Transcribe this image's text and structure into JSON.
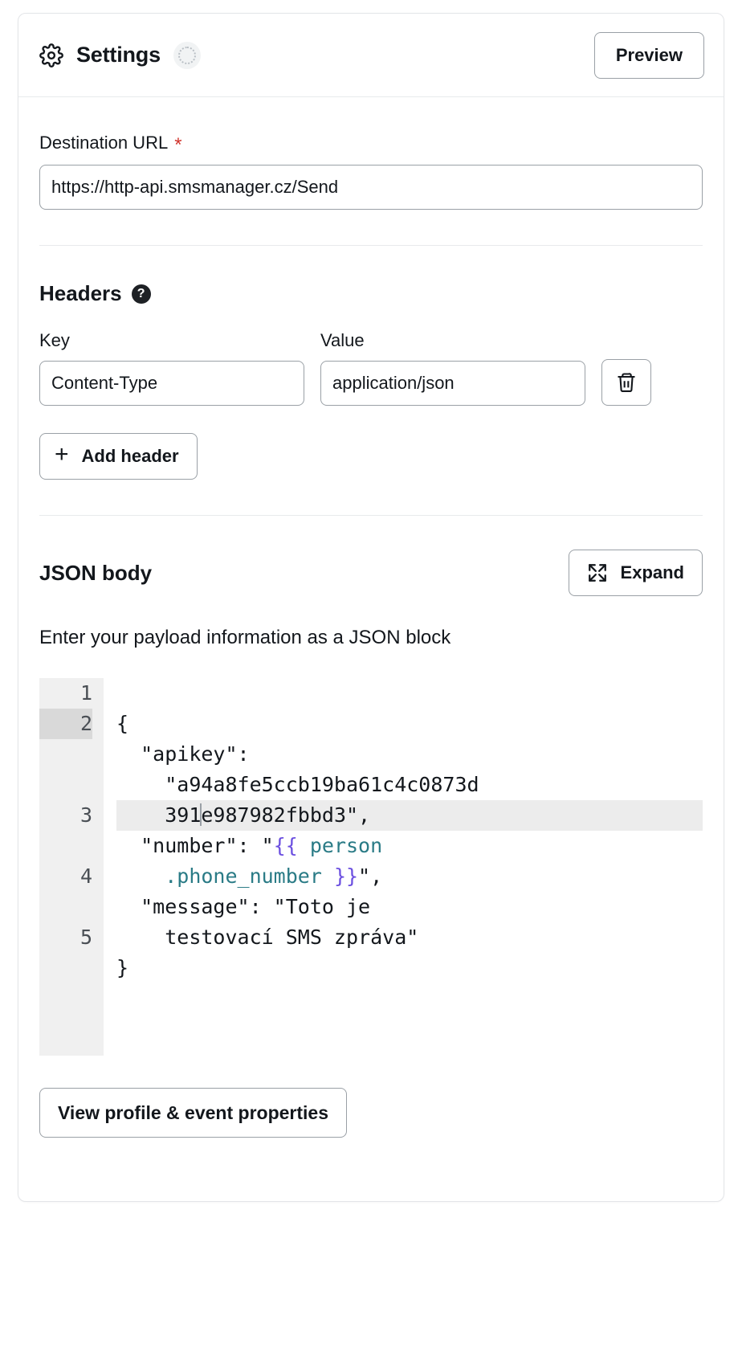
{
  "header": {
    "title": "Settings",
    "gear_icon": "gear-icon",
    "spinner_icon": "loading-spinner-icon",
    "preview_label": "Preview"
  },
  "destination": {
    "label": "Destination URL",
    "required_marker": "*",
    "value": "https://http-api.smsmanager.cz/Send",
    "placeholder": "https://"
  },
  "headers_section": {
    "title": "Headers",
    "help_glyph": "?",
    "key_label": "Key",
    "value_label": "Value",
    "rows": [
      {
        "key": "Content-Type",
        "value": "application/json"
      }
    ],
    "key_placeholder": "Key",
    "value_placeholder": "Value",
    "delete_icon": "trash-icon",
    "add_label": "Add header",
    "add_icon": "plus-icon"
  },
  "json_section": {
    "title": "JSON body",
    "expand_label": "Expand",
    "expand_icon": "expand-arrows-icon",
    "description": "Enter your payload information as a JSON block",
    "line_numbers": [
      "1",
      "2",
      "3",
      "4",
      "5"
    ],
    "active_line": 2,
    "code": {
      "line1": "{",
      "line2_key": "  \"apikey\":",
      "line2_value_a": "    \"a94a8fe5ccb19ba61c4c0873d",
      "line2_value_b": "    391",
      "line2_value_c": "e987982fbbd3\",",
      "line3_prefix": "  \"number\": \"",
      "line3_open": "{{",
      "line3_var_a": " person",
      "line3_var_b": "    .phone_number ",
      "line3_close": "}}",
      "line3_suffix": "\",",
      "line4_a": "  \"message\": \"Toto je",
      "line4_b": "    testovací SMS zpráva\"",
      "line5": "}"
    },
    "colors": {
      "brace": "#6b4fe0",
      "variable": "#2a7b86",
      "gutter_bg": "#f0f0f0",
      "active_line_bg": "#ececec"
    }
  },
  "footer": {
    "profile_button_label": "View profile & event properties"
  }
}
